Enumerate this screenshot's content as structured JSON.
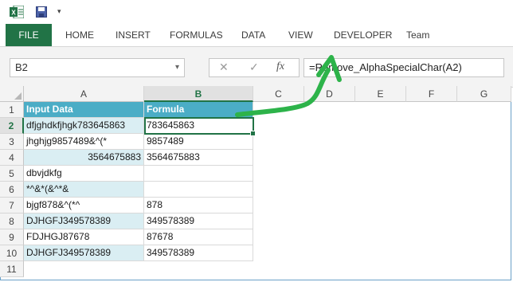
{
  "ribbon": {
    "tabs": [
      "FILE",
      "HOME",
      "INSERT",
      "FORMULAS",
      "DATA",
      "VIEW",
      "DEVELOPER",
      "Team"
    ]
  },
  "quick_access": {
    "customize_glyph": "▾"
  },
  "formula_bar": {
    "name_box": "B2",
    "name_box_dropdown": "▾",
    "cancel_glyph": "✕",
    "enter_glyph": "✓",
    "fx_label": "fx",
    "formula": "=Remove_AlphaSpecialChar(A2)"
  },
  "grid": {
    "columns": [
      "A",
      "B",
      "C",
      "D",
      "E",
      "F",
      "G"
    ],
    "rows": [
      "1",
      "2",
      "3",
      "4",
      "5",
      "6",
      "7",
      "8",
      "9",
      "10",
      "11"
    ],
    "header": {
      "a": "Input Data",
      "b": "Formula"
    },
    "data": [
      {
        "a": "dfjghdkfjhgk783645863",
        "b": "783645863"
      },
      {
        "a": "jhghjg9857489&^(*",
        "b": "9857489"
      },
      {
        "a": "3564675883",
        "b": "3564675883"
      },
      {
        "a": "dbvjdkfg",
        "b": ""
      },
      {
        "a": "*^&*(&^*&",
        "b": ""
      },
      {
        "a": "bjgf878&^(*^",
        "b": "878"
      },
      {
        "a": "DJHGFJ349578389",
        "b": "349578389"
      },
      {
        "a": "FDJHGJ87678",
        "b": "87678"
      },
      {
        "a": "DJHGFJ349578389",
        "b": "349578389"
      }
    ],
    "selected_cell": "B2"
  },
  "colors": {
    "file_tab": "#217346",
    "table_header": "#4badc6",
    "table_band": "#daeef3",
    "annotation_arrow": "#2db34a"
  }
}
